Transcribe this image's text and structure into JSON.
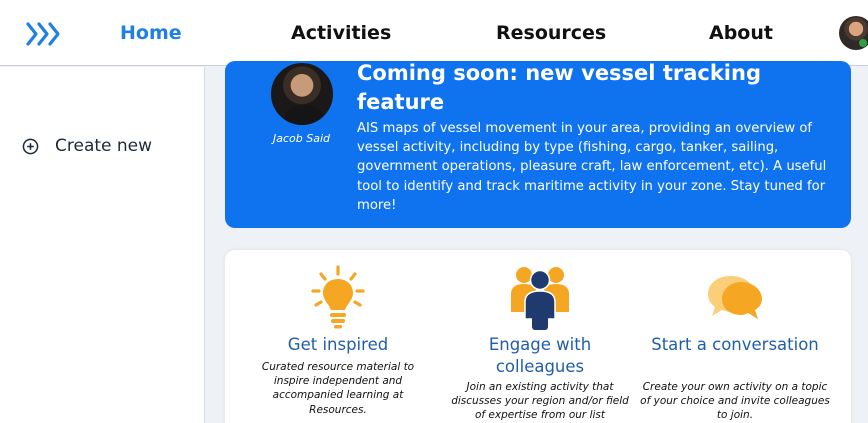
{
  "nav": {
    "home": "Home",
    "activities": "Activities",
    "resources": "Resources",
    "about": "About"
  },
  "sidebar": {
    "create_new": "Create new"
  },
  "banner": {
    "title": "Coming soon: new vessel tracking feature",
    "author": "Jacob Said",
    "text": "AIS maps of vessel movement in your area, providing an overview of vessel activity, including by type (fishing, cargo, tanker, sailing, government operations, pleasure craft, law enforcement, etc). A useful tool to identify and track maritime activity in your zone. Stay tuned for more!"
  },
  "features": [
    {
      "title": "Get inspired",
      "description": "Curated resource material to inspire independent and accompanied learning at Resources."
    },
    {
      "title": "Engage with colleagues",
      "description": "Join an existing activity that discusses your region and/or field of expertise from our list"
    },
    {
      "title": "Start a conversation",
      "description": "Create your own activity on a topic of your choice and invite colleagues to join."
    }
  ],
  "colors": {
    "accent": "#1f7fe6",
    "banner": "#0f73f0",
    "feature_title": "#1f5fa8",
    "icon_orange": "#f5a623",
    "icon_navy": "#1e3a6e"
  },
  "icons": [
    "chevrons-right-icon",
    "plus-circle-icon",
    "lightbulb-icon",
    "people-group-icon",
    "chat-bubbles-icon"
  ]
}
